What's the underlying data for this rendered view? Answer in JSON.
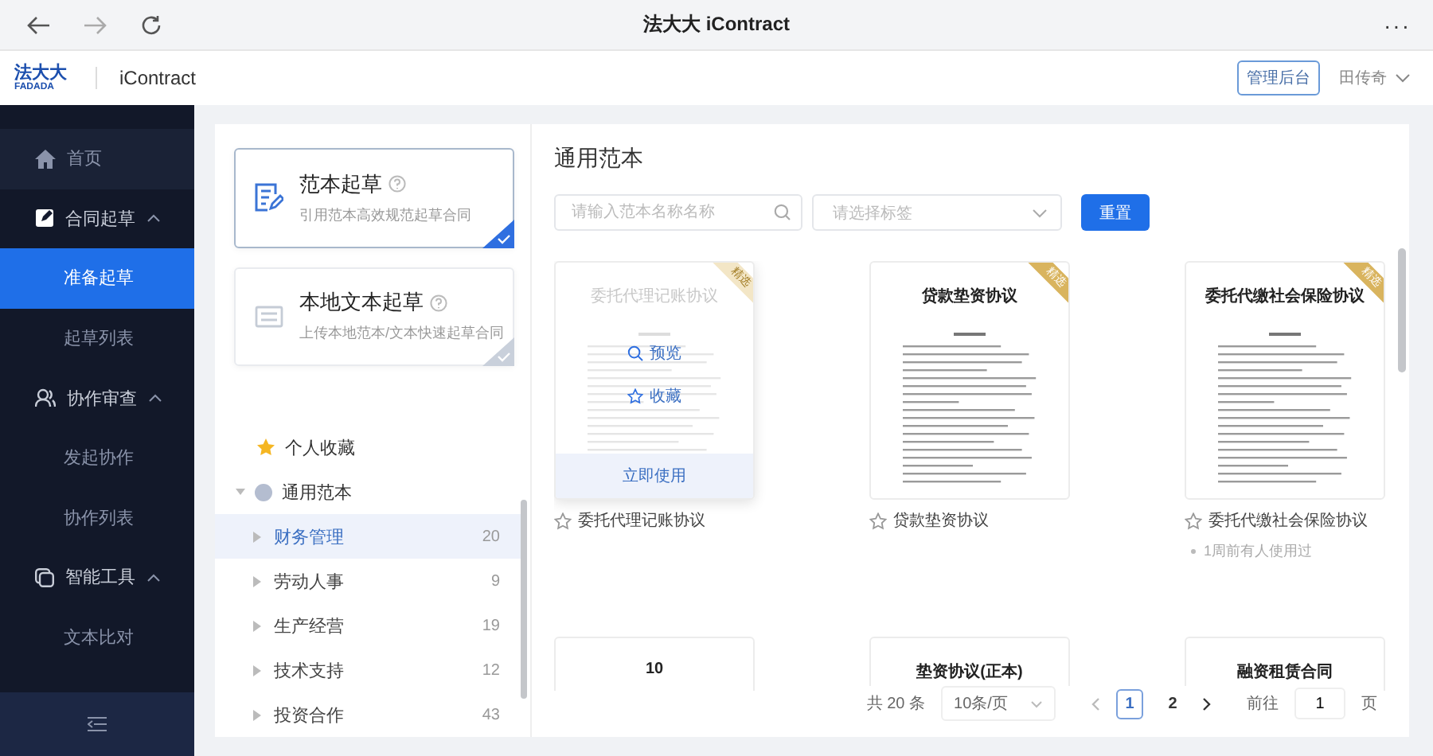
{
  "browser": {
    "title": "法大大 iContract",
    "menu": "···"
  },
  "header": {
    "logo_text": "法大大",
    "logo_sub": "FADADA",
    "app_name": "iContract",
    "admin_button": "管理后台",
    "user": "田传奇"
  },
  "sidebar": {
    "items": [
      {
        "kind": "link",
        "label": "首页",
        "selected": false
      },
      {
        "kind": "group",
        "label": "合同起草",
        "expanded": true,
        "children": [
          {
            "label": "准备起草",
            "selected": true
          },
          {
            "label": "起草列表",
            "selected": false
          }
        ]
      },
      {
        "kind": "group",
        "label": "协作审查",
        "expanded": true,
        "children": [
          {
            "label": "发起协作",
            "selected": false
          },
          {
            "label": "协作列表",
            "selected": false
          }
        ]
      },
      {
        "kind": "group",
        "label": "智能工具",
        "expanded": true,
        "children": [
          {
            "label": "文本比对",
            "selected": false
          }
        ]
      }
    ]
  },
  "modes": [
    {
      "title": "范本起草",
      "description": "引用范本高效规范起草合同",
      "selected": true
    },
    {
      "title": "本地文本起草",
      "description": "上传本地范本/文本快速起草合同",
      "selected": false
    }
  ],
  "tree": {
    "favorites": "个人收藏",
    "root": {
      "label": "通用范本",
      "expanded": true,
      "children": [
        {
          "label": "财务管理",
          "count": "20",
          "selected": true
        },
        {
          "label": "劳动人事",
          "count": "9",
          "selected": false
        },
        {
          "label": "生产经营",
          "count": "19",
          "selected": false
        },
        {
          "label": "技术支持",
          "count": "12",
          "selected": false
        },
        {
          "label": "投资合作",
          "count": "43",
          "selected": false
        }
      ]
    }
  },
  "templates": {
    "title": "通用范本",
    "search_placeholder": "请输入范本名称名称",
    "tag_placeholder": "请选择标签",
    "reset": "重置",
    "cards": [
      {
        "title": "委托代理记账协议",
        "ribbon": "精选",
        "hovered": true,
        "preview": "预览",
        "favorite": "收藏",
        "use": "立即使用",
        "name": "委托代理记账协议"
      },
      {
        "title": "贷款垫资协议",
        "ribbon": "精选",
        "hovered": false,
        "name": "贷款垫资协议"
      },
      {
        "title": "委托代缴社会保险协议",
        "ribbon": "精选",
        "hovered": false,
        "name": "委托代缴社会保险协议",
        "note": "1周前有人使用过"
      },
      {
        "title": "10",
        "hovered": false
      },
      {
        "title": "垫资协议(正本)",
        "hovered": false
      },
      {
        "title": "融资租赁合同",
        "hovered": false
      }
    ]
  },
  "pagination": {
    "total": "共 20 条",
    "page_size": "10条/页",
    "pages": [
      {
        "label": "1",
        "selected": true
      },
      {
        "label": "2",
        "selected": false
      }
    ],
    "goto_label": "前往",
    "goto_value": "1",
    "page_unit": "页"
  }
}
